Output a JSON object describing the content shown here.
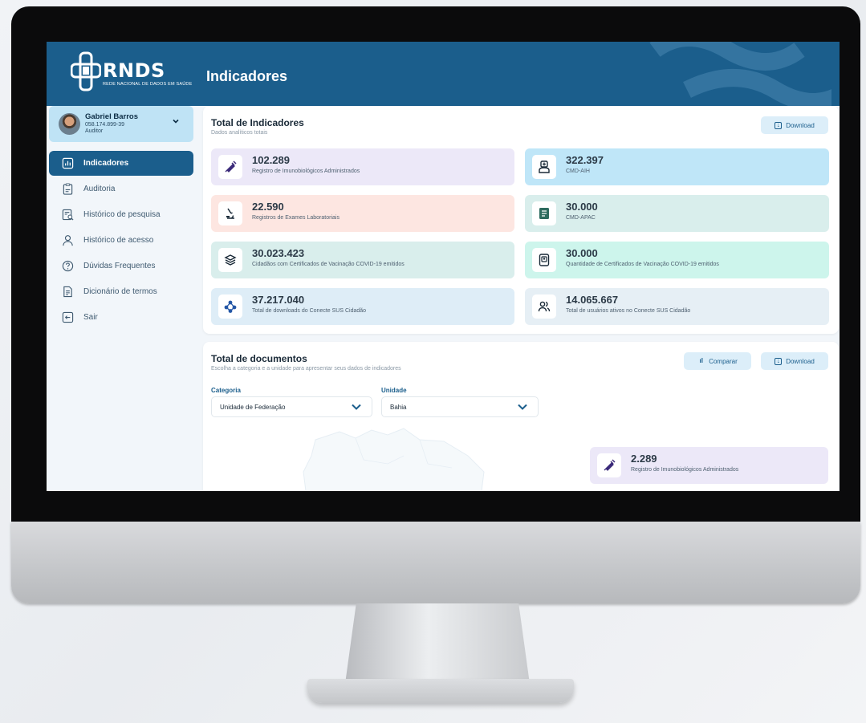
{
  "app": {
    "logo_text": "RNDS",
    "logo_subtext": "REDE NACIONAL DE DADOS EM SAÚDE",
    "page_title": "Indicadores"
  },
  "user": {
    "name": "Gabriel Barros",
    "cpf": "058.174.899-39",
    "role": "Auditor"
  },
  "sidebar": {
    "items": [
      {
        "label": "Indicadores",
        "icon": "chart-icon",
        "active": true
      },
      {
        "label": "Auditoria",
        "icon": "clipboard-icon",
        "active": false
      },
      {
        "label": "Histórico de pesquisa",
        "icon": "search-history-icon",
        "active": false
      },
      {
        "label": "Histórico de acesso",
        "icon": "user-icon",
        "active": false
      },
      {
        "label": "Dúvidas Frequentes",
        "icon": "help-icon",
        "active": false
      },
      {
        "label": "Dicionário de termos",
        "icon": "document-icon",
        "active": false
      },
      {
        "label": "Sair",
        "icon": "logout-icon",
        "active": false
      }
    ]
  },
  "indicators": {
    "title": "Total de Indicadores",
    "subtitle": "Dados analíticos totais",
    "download_label": "Download",
    "cards": [
      {
        "value": "102.289",
        "label": "Registro de Imunobiológicos Administrados",
        "icon": "syringe-icon",
        "color": "#ece8f8"
      },
      {
        "value": "322.397",
        "label": "CMD-AIH",
        "icon": "doctor-icon",
        "color": "#bfe6f8"
      },
      {
        "value": "22.590",
        "label": "Registros de Exames Laboratoriais",
        "icon": "microscope-icon",
        "color": "#fde6e1"
      },
      {
        "value": "30.000",
        "label": "CMD-APAC",
        "icon": "clipboard-list-icon",
        "color": "#d9eeec"
      },
      {
        "value": "30.023.423",
        "label": "Cidadãos com Certificados de Vacinação COVID-19 emitidos",
        "icon": "layers-icon",
        "color": "#d9eeec"
      },
      {
        "value": "30.000",
        "label": "Quantidade de Certificados de Vacinação COVID-19 emitidos",
        "icon": "certificate-icon",
        "color": "#cdf5ec"
      },
      {
        "value": "37.217.040",
        "label": "Total de downloads do Conecte SUS Cidadão",
        "icon": "network-icon",
        "color": "#deedf7"
      },
      {
        "value": "14.065.667",
        "label": "Total de usuários ativos no Conecte SUS Cidadão",
        "icon": "users-icon",
        "color": "#e6eff5"
      }
    ]
  },
  "documents": {
    "title": "Total de documentos",
    "subtitle": "Escolha a categoria e a unidade para apresentar seus dados de indicadores",
    "compare_label": "Comparar",
    "download_label": "Download",
    "category_label": "Categoria",
    "category_value": "Unidade de Federação",
    "unit_label": "Unidade",
    "unit_value": "Bahia",
    "card": {
      "value": "2.289",
      "label": "Registro de Imunobiológicos Administrados",
      "icon": "syringe-icon",
      "color": "#ece8f8"
    }
  },
  "colors": {
    "primary": "#1b5e8c",
    "accent_light": "#dceef9"
  }
}
